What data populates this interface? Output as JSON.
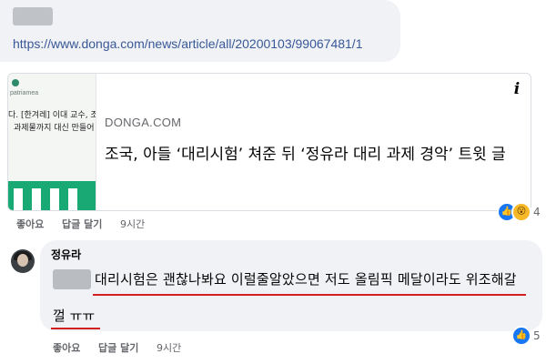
{
  "comment_1": {
    "url": "https://www.donga.com/news/article/all/20200103/99067481/1",
    "preview": {
      "thumb_brand": "patriamea",
      "thumb_line_1": "다. [한겨레] 이대 교수, 조",
      "thumb_line_2": "과제물까지 대신 만들어",
      "info_icon": "i",
      "source": "DONGA.COM",
      "title": "조국, 아들 ‘대리시험’ 쳐준 뒤 ‘정유라 대리 과제 경악’ 트윗 글"
    },
    "reactions": {
      "icons": [
        "like-icon",
        "wow-icon"
      ],
      "count": "4"
    },
    "actions": {
      "like": "좋아요",
      "reply": "답글 달기",
      "time": "9시간"
    }
  },
  "comment_2": {
    "author": "정유라",
    "text_line_1": "대리시험은 괜찮나봐요 이럴줄알았으면 저도 올림픽 메달이라도 위조해갈",
    "text_line_2": "껄 ㅠㅠ",
    "reactions": {
      "icons": [
        "like-icon"
      ],
      "count": "5"
    },
    "actions": {
      "like": "좋아요",
      "reply": "답글 달기",
      "time": "9시간"
    }
  },
  "colors": {
    "link": "#385898",
    "bubble": "#f0f2f5",
    "like_blue": "#1877f2",
    "underline_red": "#d21f1f",
    "thumb_green": "#19a974"
  }
}
